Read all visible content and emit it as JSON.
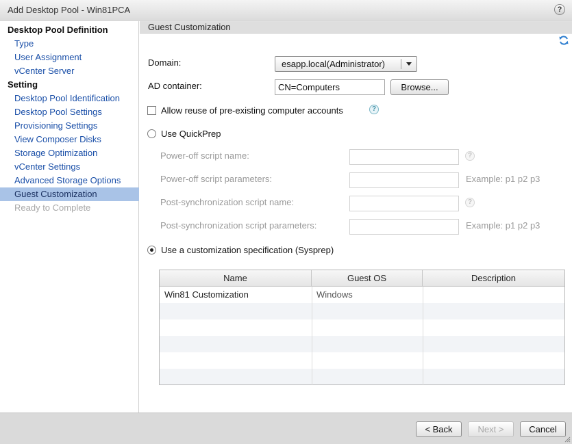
{
  "window": {
    "title": "Add Desktop Pool - Win81PCA",
    "help_glyph": "?"
  },
  "sidebar": {
    "items": [
      {
        "label": "Desktop Pool Definition",
        "kind": "heading"
      },
      {
        "label": "Type",
        "kind": "link"
      },
      {
        "label": "User Assignment",
        "kind": "link"
      },
      {
        "label": "vCenter Server",
        "kind": "link"
      },
      {
        "label": "Setting",
        "kind": "heading"
      },
      {
        "label": "Desktop Pool Identification",
        "kind": "link"
      },
      {
        "label": "Desktop Pool Settings",
        "kind": "link"
      },
      {
        "label": "Provisioning Settings",
        "kind": "link"
      },
      {
        "label": "View Composer Disks",
        "kind": "link"
      },
      {
        "label": "Storage Optimization",
        "kind": "link"
      },
      {
        "label": "vCenter Settings",
        "kind": "link"
      },
      {
        "label": "Advanced Storage Options",
        "kind": "link"
      },
      {
        "label": "Guest Customization",
        "kind": "active"
      },
      {
        "label": "Ready to Complete",
        "kind": "disabled"
      }
    ]
  },
  "main": {
    "section_title": "Guest Customization",
    "domain": {
      "label": "Domain:",
      "value": "esapp.local(Administrator)"
    },
    "ad_container": {
      "label": "AD container:",
      "value": "CN=Computers",
      "browse_label": "Browse..."
    },
    "allow_reuse": {
      "label": "Allow reuse of pre-existing computer accounts",
      "checked": false
    },
    "quickprep": {
      "label": "Use QuickPrep",
      "selected": false,
      "poweroff_name_label": "Power-off script name:",
      "poweroff_params_label": "Power-off script parameters:",
      "postsync_name_label": "Post-synchronization script name:",
      "postsync_params_label": "Post-synchronization script parameters:",
      "example_text": "Example: p1 p2 p3"
    },
    "sysprep": {
      "label": "Use a customization specification (Sysprep)",
      "selected": true
    },
    "table": {
      "columns": [
        "Name",
        "Guest OS",
        "Description"
      ],
      "rows": [
        {
          "name": "Win81 Customization",
          "guest_os": "Windows",
          "description": ""
        }
      ]
    }
  },
  "footer": {
    "back_label": "< Back",
    "next_label": "Next >",
    "cancel_label": "Cancel"
  },
  "colors": {
    "link": "#1a4fa8",
    "active_bg": "#a9c3e7",
    "footer_bg": "#dadada"
  },
  "icons": {
    "refresh": "refresh-icon",
    "help": "question-mark-icon"
  }
}
